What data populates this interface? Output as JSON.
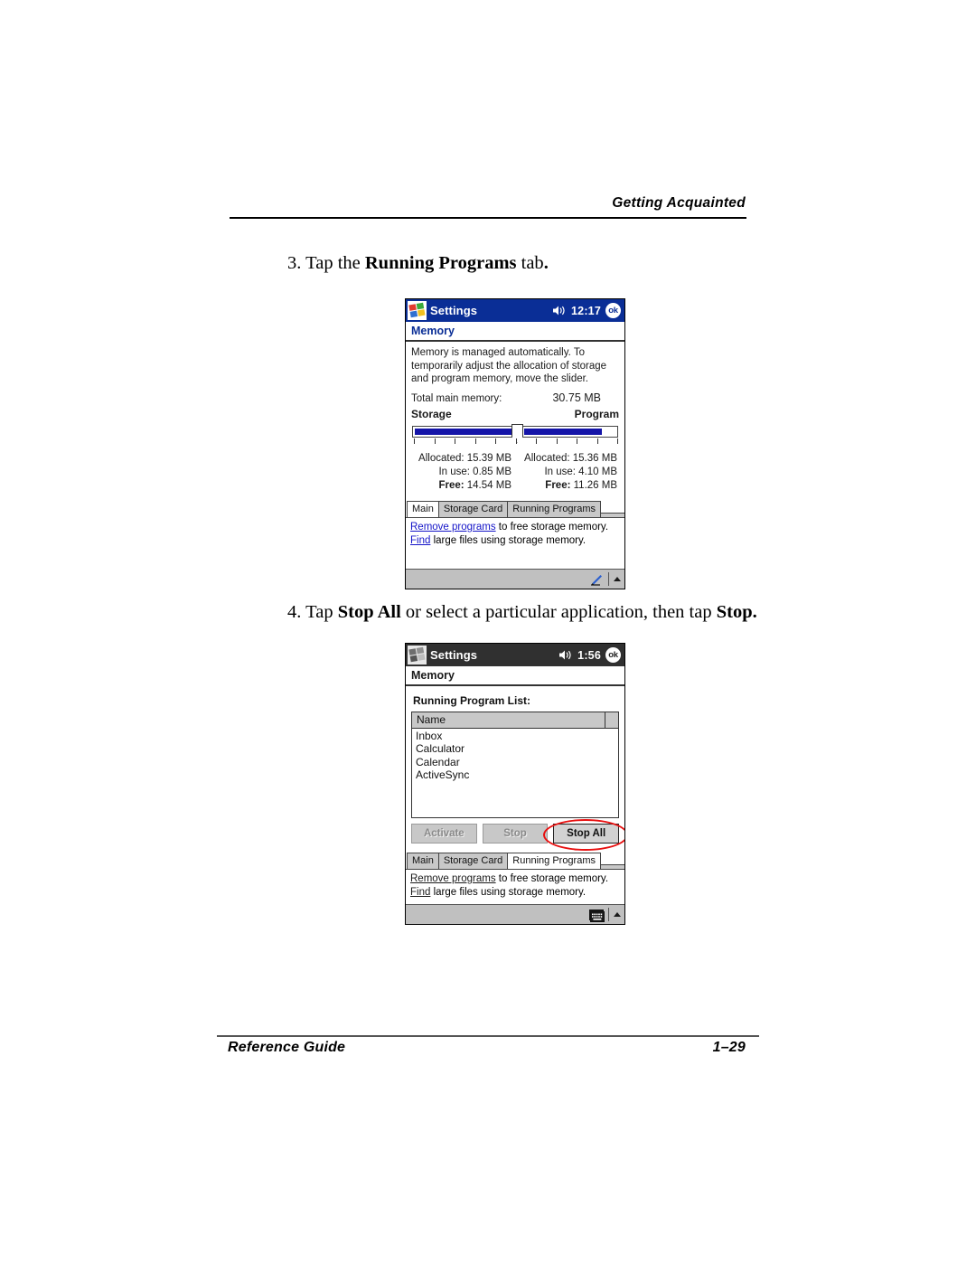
{
  "page": {
    "header_title": "Getting Acquainted",
    "footer_left": "Reference Guide",
    "footer_page": "1–29"
  },
  "steps": {
    "step3": {
      "number": "3.",
      "text_before": "Tap the ",
      "bold": "Running Programs",
      "text_after": " tab",
      "period": "."
    },
    "step4": {
      "number": "4.",
      "text_before": "Tap ",
      "bold1": "Stop All",
      "text_mid": " or select a particular application, then tap ",
      "bold2": "Stop."
    }
  },
  "screenshot1": {
    "titlebar": {
      "app": "Settings",
      "time": "12:17",
      "ok": "ok",
      "bg_color": "#0a2e96"
    },
    "app_header": "Memory",
    "description": [
      "Memory is managed automatically. To",
      "temporarily adjust the allocation of storage",
      "and program memory, move the slider."
    ],
    "total": {
      "label": "Total main memory:",
      "value": "30.75 MB"
    },
    "slider": {
      "left_label": "Storage",
      "right_label": "Program",
      "fill_color": "#1414a8",
      "position_percent": 50
    },
    "storage": {
      "allocated_label": "Allocated:",
      "allocated_value": "15.39 MB",
      "inuse_label": "In use:",
      "inuse_value": "0.85 MB",
      "free_label": "Free:",
      "free_value": "14.54 MB"
    },
    "program": {
      "allocated_label": "Allocated:",
      "allocated_value": "15.36 MB",
      "inuse_label": "In use:",
      "inuse_value": "4.10 MB",
      "free_label": "Free:",
      "free_value": "11.26 MB"
    },
    "tabs": [
      {
        "label": "Main",
        "active": true
      },
      {
        "label": "Storage Card",
        "active": false
      },
      {
        "label": "Running Programs",
        "active": false
      }
    ],
    "links": {
      "line1_link": "Remove programs",
      "line1_rest": " to free storage memory.",
      "line2_link": "Find",
      "line2_rest": " large files using storage memory.",
      "link_color": "#1414c8"
    },
    "bottombar": {
      "icon": "pencil-icon",
      "arrow": "up-arrow-icon"
    }
  },
  "screenshot2": {
    "titlebar": {
      "app": "Settings",
      "time": "1:56",
      "ok": "ok",
      "bg_color": "#303030"
    },
    "app_header": "Memory",
    "list_label": "Running Program List:",
    "list_column": "Name",
    "programs": [
      "Inbox",
      "Calculator",
      "Calendar",
      "ActiveSync"
    ],
    "buttons": [
      {
        "label": "Activate",
        "enabled": false
      },
      {
        "label": "Stop",
        "enabled": false
      },
      {
        "label": "Stop All",
        "enabled": true
      }
    ],
    "annotation": {
      "shape": "ellipse",
      "color": "#e81010",
      "target": "Stop All"
    },
    "tabs": [
      {
        "label": "Main",
        "active": false
      },
      {
        "label": "Storage Card",
        "active": false
      },
      {
        "label": "Running Programs",
        "active": true
      }
    ],
    "links": {
      "line1_link": "Remove programs",
      "line1_rest": " to free storage memory.",
      "line2_link": "Find",
      "line2_rest": " large files using storage memory."
    },
    "bottombar": {
      "icon": "keyboard-icon",
      "arrow": "up-arrow-icon"
    }
  }
}
